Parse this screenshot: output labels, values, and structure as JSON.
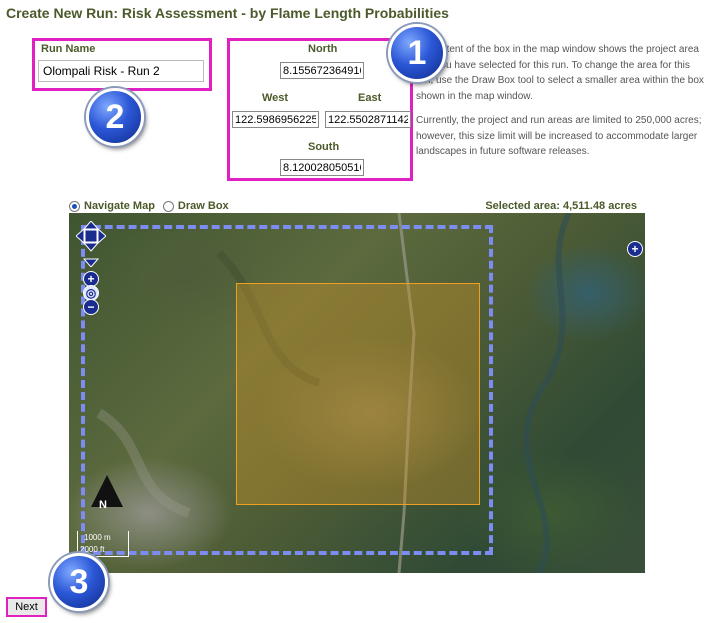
{
  "page": {
    "title": "Create New Run: Risk Assessment - by Flame Length Probabilities"
  },
  "run_name": {
    "label": "Run Name",
    "value": "Olompali Risk - Run 2"
  },
  "coordinates": {
    "north_label": "North",
    "north_value": "8.155672364916",
    "west_label": "West",
    "west_value": "122.5986956225",
    "east_label": "East",
    "east_value": "122.5502871142",
    "south_label": "South",
    "south_value": "8.120028050516"
  },
  "info": {
    "paragraph1": "The extent of the box in the map window shows the project area that you have selected for this run. To change the area for this run, use the Draw Box tool to select a smaller area within the box shown in the map window.",
    "paragraph2": "Currently, the project and run areas are limited to 250,000 acres; however, this size limit will be increased to accommodate larger landscapes in future software releases."
  },
  "badges": {
    "one": "1",
    "two": "2",
    "three": "3"
  },
  "map_controls": {
    "navigate_label": "Navigate Map",
    "draw_label": "Draw Box",
    "selected_mode": "Navigate Map",
    "selected_area": "Selected area: 4,511.48 acres",
    "north_letter": "N",
    "scale_top": "1000 m",
    "scale_bottom": "2000 ft"
  },
  "actions": {
    "next_label": "Next"
  },
  "icons": [
    "pan-arrows-icon",
    "zoom-in-icon",
    "globe-icon",
    "zoom-out-icon",
    "expand-layers-icon",
    "north-arrow-icon"
  ],
  "colors": {
    "highlight": "#e020c0",
    "extent_dash": "#7c8cf0",
    "run_area": "#f0a020",
    "badge": "#2b57d6"
  }
}
